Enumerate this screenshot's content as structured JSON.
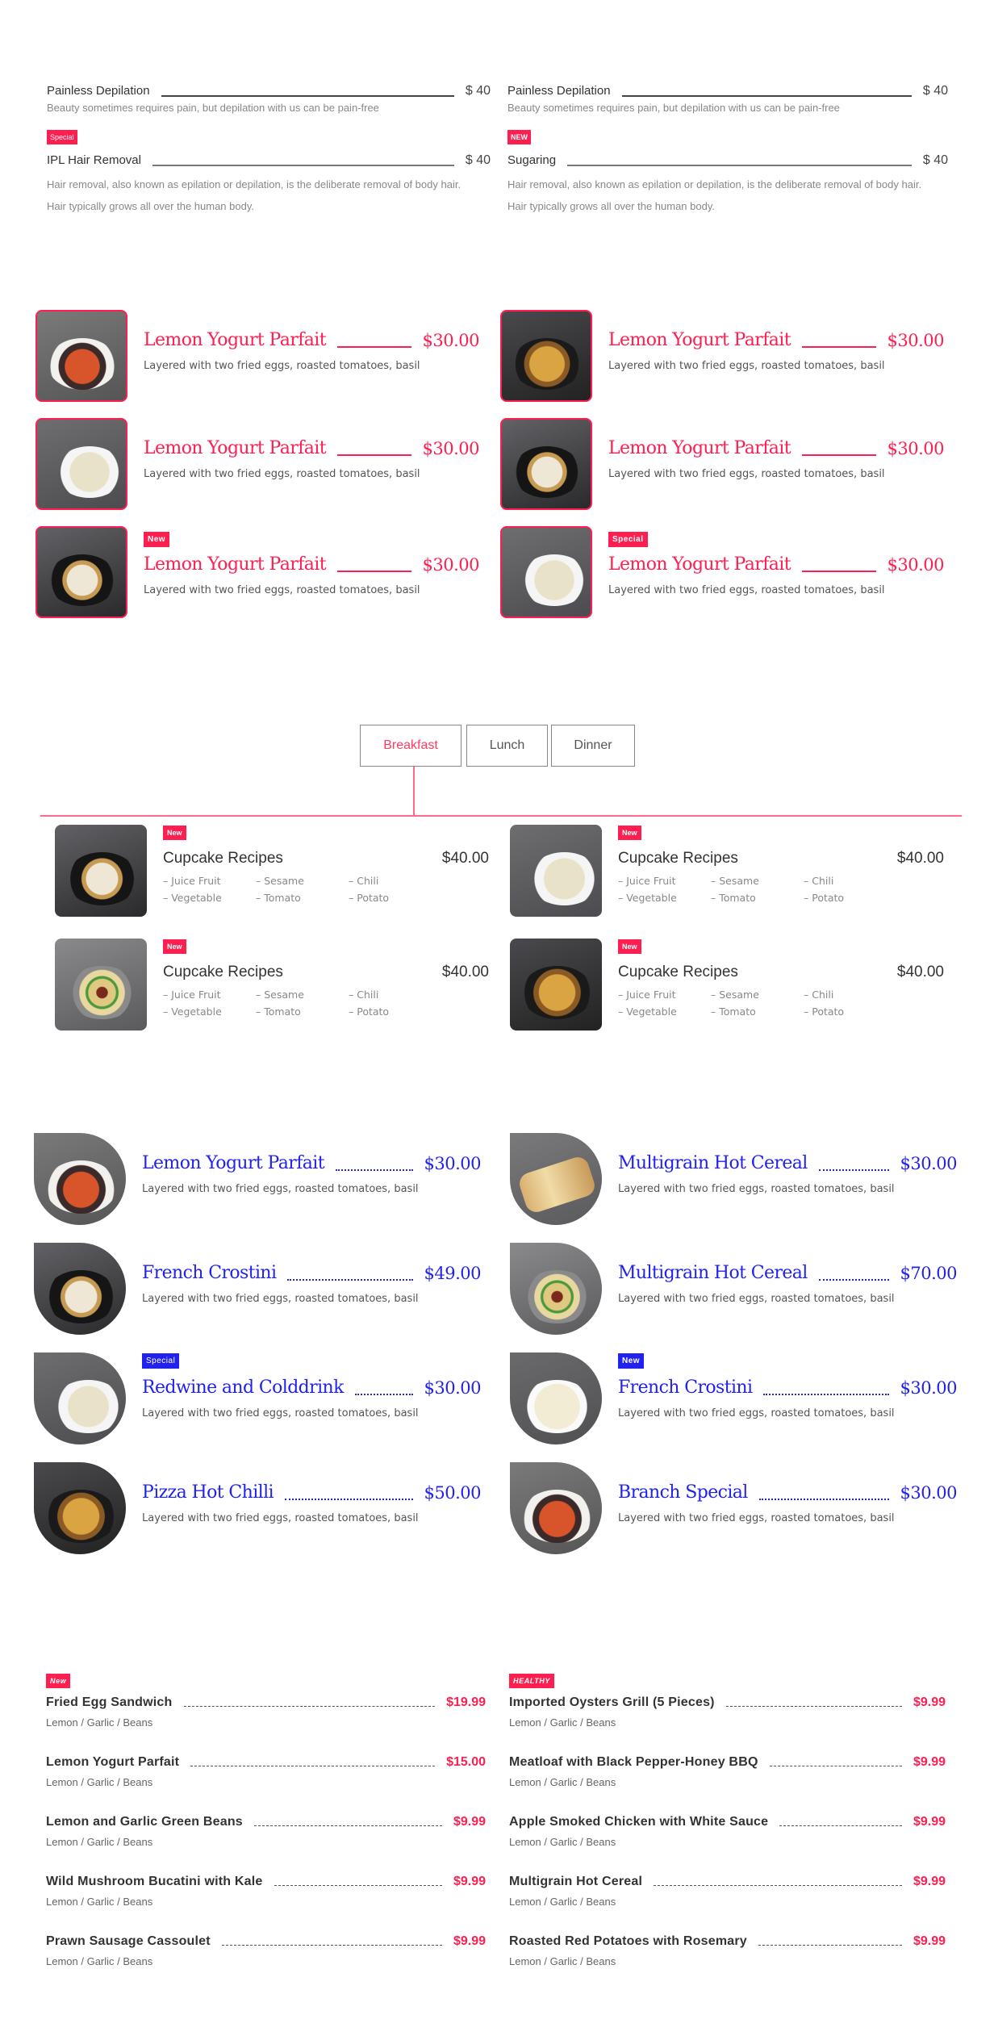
{
  "section1": {
    "left": [
      {
        "name": "Painless Depilation",
        "price": "$ 40",
        "badge": null,
        "desc": [
          "Beauty sometimes requires pain, but depilation with us can be pain-free"
        ]
      },
      {
        "name": "IPL Hair Removal",
        "price": "$ 40",
        "badge": "Special",
        "desc": [
          "Hair removal, also known as epilation or depilation, is the deliberate removal of body hair.",
          "Hair typically grows all over the human body."
        ]
      }
    ],
    "right": [
      {
        "name": "Painless Depilation",
        "price": "$ 40",
        "badge": null,
        "desc": [
          "Beauty sometimes requires pain, but depilation with us can be pain-free"
        ]
      },
      {
        "name": "Sugaring",
        "price": "$ 40",
        "badge": "NEW",
        "desc": [
          "Hair removal, also known as epilation or depilation, is the deliberate removal of body hair.",
          "Hair typically grows all over the human body."
        ]
      }
    ]
  },
  "section2": {
    "accent": "#ff1e50",
    "items": [
      {
        "name": "Lemon Yogurt Parfait",
        "price": "$30.00",
        "desc": "Layered with two fried eggs, roasted tomatoes, basil",
        "badge": null,
        "image": "seafood-noodle-soup"
      },
      {
        "name": "Lemon Yogurt Parfait",
        "price": "$30.00",
        "desc": "Layered with two fried eggs, roasted tomatoes, basil",
        "badge": null,
        "image": "ramen-bowl"
      },
      {
        "name": "Lemon Yogurt Parfait",
        "price": "$30.00",
        "desc": "Layered with two fried eggs, roasted tomatoes, basil",
        "badge": null,
        "image": "dumplings-plate"
      },
      {
        "name": "Lemon Yogurt Parfait",
        "price": "$30.00",
        "desc": "Layered with two fried eggs, roasted tomatoes, basil",
        "badge": null,
        "image": "udon-skewers"
      },
      {
        "name": "Lemon Yogurt Parfait",
        "price": "$30.00",
        "desc": "Layered with two fried eggs, roasted tomatoes, basil",
        "badge": "New",
        "image": "udon-skewers"
      },
      {
        "name": "Lemon Yogurt Parfait",
        "price": "$30.00",
        "desc": "Layered with two fried eggs, roasted tomatoes, basil",
        "badge": "Special",
        "image": "dumplings-plate"
      }
    ]
  },
  "section3": {
    "tabs": [
      {
        "label": "Breakfast",
        "active": true
      },
      {
        "label": "Lunch",
        "active": false
      },
      {
        "label": "Dinner",
        "active": false
      }
    ],
    "items": [
      {
        "badge": "New",
        "name": "Cupcake Recipes",
        "price": "$40.00",
        "ingredients": [
          "– Juice Fruit",
          "– Sesame",
          "– Chili",
          "– Vegetable",
          "– Tomato",
          "– Potato"
        ],
        "image": "udon-skewers"
      },
      {
        "badge": "New",
        "name": "Cupcake Recipes",
        "price": "$40.00",
        "ingredients": [
          "– Juice Fruit",
          "– Sesame",
          "– Chili",
          "– Vegetable",
          "– Tomato",
          "– Potato"
        ],
        "image": "dumplings-plate"
      },
      {
        "badge": "New",
        "name": "Cupcake Recipes",
        "price": "$40.00",
        "ingredients": [
          "– Juice Fruit",
          "– Sesame",
          "– Chili",
          "– Vegetable",
          "– Tomato",
          "– Potato"
        ],
        "image": "hotpot"
      },
      {
        "badge": "New",
        "name": "Cupcake Recipes",
        "price": "$40.00",
        "ingredients": [
          "– Juice Fruit",
          "– Sesame",
          "– Chili",
          "– Vegetable",
          "– Tomato",
          "– Potato"
        ],
        "image": "ramen-bowl"
      }
    ]
  },
  "section4": {
    "accent": "#2222ee",
    "items": [
      {
        "name": "Lemon Yogurt Parfait",
        "price": "$30.00",
        "desc": "Layered with two fried eggs, roasted tomatoes, basil",
        "badge": null,
        "image": "seafood-noodle-soup"
      },
      {
        "name": "Multigrain Hot Cereal",
        "price": "$30.00",
        "desc": "Layered with two fried eggs, roasted tomatoes, basil",
        "badge": null,
        "image": "gyoza-board"
      },
      {
        "name": "French Crostini",
        "price": "$49.00",
        "desc": "Layered with two fried eggs, roasted tomatoes, basil",
        "badge": null,
        "image": "udon-skewers"
      },
      {
        "name": "Multigrain Hot Cereal",
        "price": "$70.00",
        "desc": "Layered with two fried eggs, roasted tomatoes, basil",
        "badge": null,
        "image": "hotpot"
      },
      {
        "name": "Redwine and Colddrink",
        "price": "$30.00",
        "desc": "Layered with two fried eggs, roasted tomatoes, basil",
        "badge": "Special",
        "image": "dumplings-plate"
      },
      {
        "name": "French Crostini",
        "price": "$30.00",
        "desc": "Layered with two fried eggs, roasted tomatoes, basil",
        "badge": "New",
        "image": "steamed-buns"
      },
      {
        "name": "Pizza Hot Chilli",
        "price": "$50.00",
        "desc": "Layered with two fried eggs, roasted tomatoes, basil",
        "badge": null,
        "image": "ramen-bowl"
      },
      {
        "name": "Branch Special",
        "price": "$30.00",
        "desc": "Layered with two fried eggs, roasted tomatoes, basil",
        "badge": null,
        "image": "seafood-noodle-soup"
      }
    ]
  },
  "section5": {
    "left_badge": "New",
    "right_badge": "HEALTHY",
    "left": [
      {
        "name": "Fried Egg Sandwich",
        "price": "$19.99",
        "desc": "Lemon / Garlic / Beans"
      },
      {
        "name": "Lemon Yogurt Parfait",
        "price": "$15.00",
        "desc": "Lemon / Garlic / Beans"
      },
      {
        "name": "Lemon and Garlic Green Beans",
        "price": "$9.99",
        "desc": "Lemon / Garlic / Beans"
      },
      {
        "name": "Wild Mushroom Bucatini with Kale",
        "price": "$9.99",
        "desc": "Lemon / Garlic / Beans"
      },
      {
        "name": "Prawn Sausage Cassoulet",
        "price": "$9.99",
        "desc": "Lemon / Garlic / Beans"
      }
    ],
    "right": [
      {
        "name": "Imported Oysters Grill (5 Pieces)",
        "price": "$9.99",
        "desc": "Lemon / Garlic / Beans"
      },
      {
        "name": "Meatloaf with Black Pepper-Honey BBQ",
        "price": "$9.99",
        "desc": "Lemon / Garlic / Beans"
      },
      {
        "name": "Apple Smoked Chicken with White Sauce",
        "price": "$9.99",
        "desc": "Lemon / Garlic / Beans"
      },
      {
        "name": "Multigrain Hot Cereal",
        "price": "$9.99",
        "desc": "Lemon / Garlic / Beans"
      },
      {
        "name": "Roasted Red Potatoes with Rosemary",
        "price": "$9.99",
        "desc": "Lemon / Garlic / Beans"
      }
    ]
  }
}
